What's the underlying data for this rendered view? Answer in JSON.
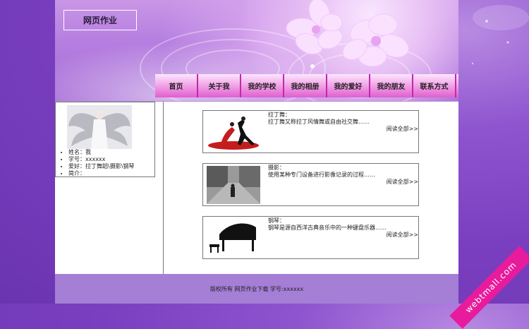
{
  "header": {
    "logo_text": "网页作业"
  },
  "nav": {
    "items": [
      {
        "label": "首页"
      },
      {
        "label": "关于我"
      },
      {
        "label": "我的学校"
      },
      {
        "label": "我的相册"
      },
      {
        "label": "我的爱好"
      },
      {
        "label": "我的朋友"
      },
      {
        "label": "联系方式"
      }
    ]
  },
  "profile": {
    "lines": [
      "姓名：我",
      "学号：xxxxxx",
      "爱好：拉丁舞蹈\\摄影\\钢琴",
      "简介："
    ]
  },
  "articles": [
    {
      "title": "拉丁舞：",
      "desc": "拉丁舞又称拉丁风情舞或自由社交舞……",
      "more": "阅读全部>>"
    },
    {
      "title": "摄影：",
      "desc": "使用某种专门设备进行影像记录的过程……",
      "more": "阅读全部>>"
    },
    {
      "title": "钢琴：",
      "desc": "钢琴是源自西洋古典音乐中的一种键盘乐器……",
      "more": "阅读全部>>"
    }
  ],
  "footer": {
    "text": "版权所有  网页作业下载  学号:xxxxxx"
  },
  "watermark": {
    "text": "webtmall.com"
  },
  "colors": {
    "bg_purple": "#7a3fc0",
    "nav_pink": "#e05fcf",
    "footer": "#a57ed6",
    "watermark": "#e81b9c"
  }
}
